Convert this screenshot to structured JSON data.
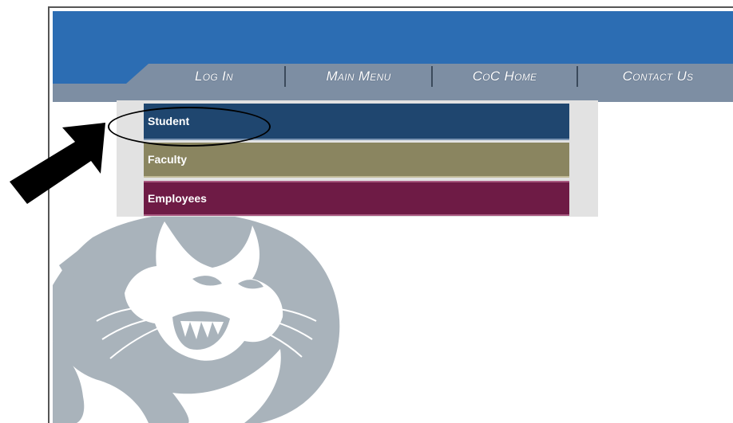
{
  "nav": {
    "items": [
      {
        "label": "Log In"
      },
      {
        "label": "Main Menu"
      },
      {
        "label": "CoC Home"
      },
      {
        "label": "Contact Us"
      }
    ]
  },
  "menu": {
    "items": [
      {
        "label": "Student",
        "color": "#1f466f"
      },
      {
        "label": "Faculty",
        "color": "#8a8560"
      },
      {
        "label": "Employees",
        "color": "#6e1b45"
      }
    ]
  },
  "colors": {
    "header": "#2c6db3",
    "nav_bar": "#7d8ea3",
    "mascot": "#a9b3bb"
  },
  "icons": {
    "annotation_arrow": "arrow-icon",
    "mascot": "cougar-mascot-icon"
  }
}
